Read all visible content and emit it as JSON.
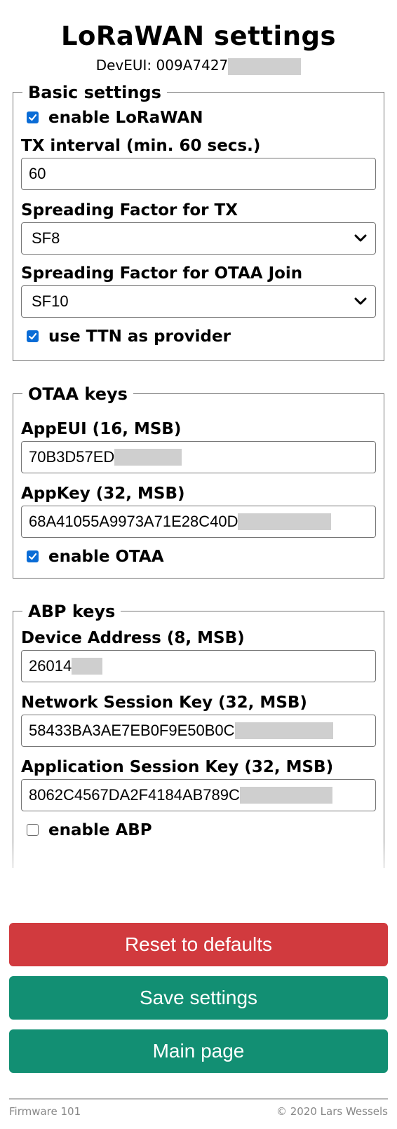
{
  "page": {
    "title": "LoRaWAN settings",
    "deveui_label": "DevEUI: 009A7427"
  },
  "basic": {
    "legend": "Basic settings",
    "enable_lorawan": {
      "label": "enable LoRaWAN",
      "checked": true
    },
    "tx_interval": {
      "label": "TX interval (min. 60 secs.)",
      "value": "60"
    },
    "sf_tx": {
      "label": "Spreading Factor for TX",
      "value": "SF8"
    },
    "sf_join": {
      "label": "Spreading Factor for OTAA Join",
      "value": "SF10"
    },
    "use_ttn": {
      "label": "use TTN as provider",
      "checked": true
    }
  },
  "otaa": {
    "legend": "OTAA keys",
    "appeui": {
      "label": "AppEUI (16, MSB)",
      "value": "70B3D57ED"
    },
    "appkey": {
      "label": "AppKey (32, MSB)",
      "value": "68A41055A9973A71E28C40D"
    },
    "enable_otaa": {
      "label": "enable OTAA",
      "checked": true
    }
  },
  "abp": {
    "legend": "ABP keys",
    "devaddr": {
      "label": "Device Address (8, MSB)",
      "value": "26014"
    },
    "nwkskey": {
      "label": "Network Session Key (32, MSB)",
      "value": "58433BA3AE7EB0F9E50B0C"
    },
    "appskey": {
      "label": "Application Session Key (32, MSB)",
      "value": "8062C4567DA2F4184AB789C"
    },
    "enable_abp": {
      "label": "enable ABP",
      "checked": false
    }
  },
  "buttons": {
    "reset": "Reset to defaults",
    "save": "Save settings",
    "main": "Main page"
  },
  "footer": {
    "firmware": "Firmware 101",
    "copyright": "© 2020 Lars Wessels"
  },
  "colors": {
    "reset": "#d13a3e",
    "primary": "#128f73",
    "checkbox": "#0a6cd6"
  }
}
